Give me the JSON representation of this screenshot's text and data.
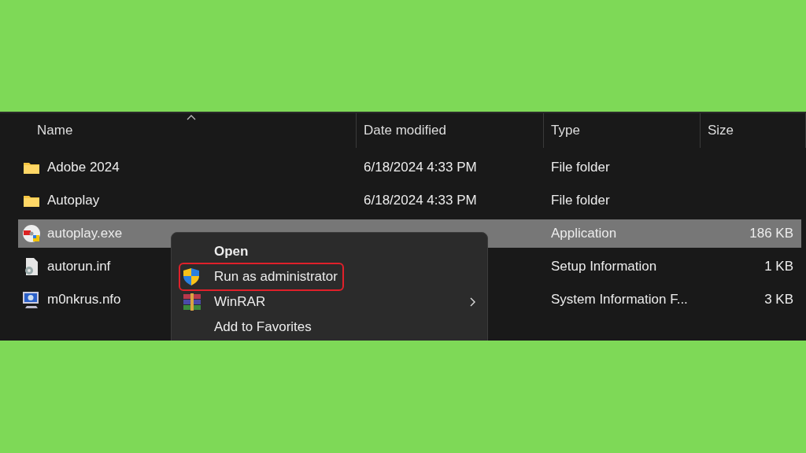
{
  "columns": [
    {
      "label": "Name",
      "sorted": true
    },
    {
      "label": "Date modified",
      "sorted": false
    },
    {
      "label": "Type",
      "sorted": false
    },
    {
      "label": "Size",
      "sorted": false
    }
  ],
  "rows": [
    {
      "kind": "folder",
      "name": "Adobe 2024",
      "date": "6/18/2024 4:33 PM",
      "type": "File folder",
      "selected": false
    },
    {
      "kind": "folder",
      "name": "Autoplay",
      "date": "6/18/2024 4:33 PM",
      "type": "File folder",
      "selected": false
    },
    {
      "kind": "exe",
      "name": "autoplay.exe",
      "type": "Application",
      "size": "186 KB",
      "selected": true
    },
    {
      "kind": "inf",
      "name": "autorun.inf",
      "type": "Setup Information",
      "size": "1 KB",
      "selected": false
    },
    {
      "kind": "nfo",
      "name": "m0nkrus.nfo",
      "type": "System Information F...",
      "size": "3 KB",
      "selected": false
    }
  ],
  "context_menu": {
    "items": [
      {
        "label": "Open",
        "default": true,
        "highlighted": false,
        "submenu": false
      },
      {
        "label": "Run as administrator",
        "kind": "shield",
        "default": false,
        "highlighted": true,
        "submenu": false
      },
      {
        "label": "WinRAR",
        "kind": "archive",
        "default": false,
        "highlighted": false,
        "submenu": true
      },
      {
        "label": "Add to Favorites",
        "default": false,
        "highlighted": false,
        "submenu": false
      }
    ]
  }
}
